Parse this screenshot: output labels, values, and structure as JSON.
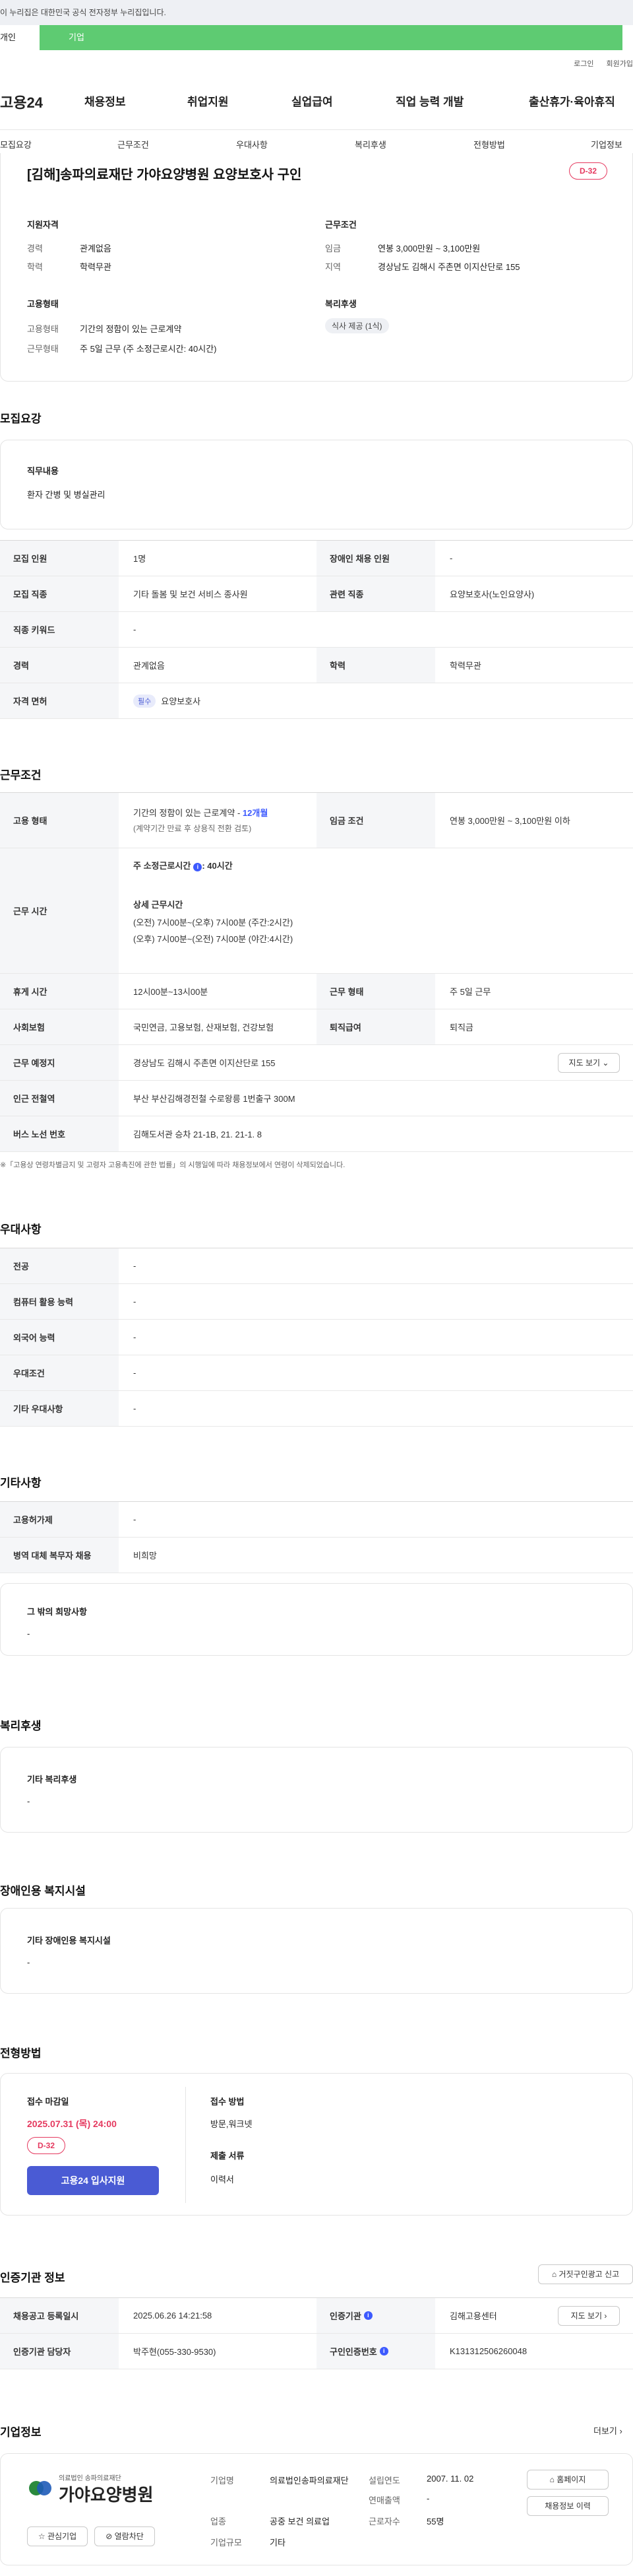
{
  "gov_banner": "이 누리집은 대한민국 공식 전자정부 누리집입니다.",
  "user_tabs": {
    "personal": "개인",
    "company": "기업"
  },
  "util": {
    "login": "로그인",
    "join": "회원가입"
  },
  "gnb": {
    "logo": "고용24",
    "menus": [
      "채용정보",
      "취업지원",
      "실업급여",
      "직업 능력 개발",
      "출산휴가·육아휴직"
    ]
  },
  "snb": [
    "모집요강",
    "근무조건",
    "우대사항",
    "복리후생",
    "전형방법",
    "기업정보"
  ],
  "summary": {
    "title": "[김해]송파의료재단 가야요양병원 요양보호사 구인",
    "dday": "D-32",
    "qualification": {
      "heading": "지원자격",
      "career_label": "경력",
      "career": "관계없음",
      "edu_label": "학력",
      "edu": "학력무관"
    },
    "employment": {
      "heading": "고용형태",
      "type_label": "고용형태",
      "type": "기간의 정함이 있는 근로계약",
      "form_label": "근무형태",
      "form": "주 5일 근무 (주 소정근로시간: 40시간)"
    },
    "conditions": {
      "heading": "근무조건",
      "wage_label": "임금",
      "wage": "연봉 3,000만원 ~ 3,100만원",
      "region_label": "지역",
      "region": "경상남도 김해시 주촌면 이지산단로 155"
    },
    "welfare": {
      "heading": "복리후생",
      "chip": "식사 제공 (1식)"
    }
  },
  "recruit": {
    "title": "모집요강",
    "duty_heading": "직무내용",
    "duty": "환자 간병 및 병실관리",
    "rows": [
      {
        "l1": "모집 인원",
        "v1": "1명",
        "l2": "장애인 채용 인원",
        "v2": "-"
      },
      {
        "l1": "모집 직종",
        "v1": "기타 돌봄 및 보건 서비스 종사원",
        "l2": "관련 직종",
        "v2": "요양보호사(노인요양사)"
      },
      {
        "l1": "직종 키워드",
        "v1": "-"
      },
      {
        "l1": "경력",
        "v1": "관계없음",
        "l2": "학력",
        "v2": "학력무관"
      },
      {
        "l1": "자격 면허",
        "pill": "필수",
        "v1": "요양보호사"
      }
    ]
  },
  "work": {
    "title": "근무조건",
    "emp_label": "고용 형태",
    "emp_line1": "기간의 정함이 있는 근로계약 - ",
    "emp_months": "12개월",
    "emp_line2": "(계약기간 만료 후 상용직 전환 검토)",
    "wage_label": "임금 조건",
    "wage": "연봉 3,000만원 ~ 3,100만원 이하",
    "hours_label": "근무 시간",
    "hours_weekly_label": "주 소정근로시간",
    "hours_weekly": ": 40시간",
    "hours_detail_heading": "상세 근무시간",
    "hours_detail": [
      "(오전) 7시00분~(오후) 7시00분  (주간:2시간)",
      "(오후) 7시00분~(오전) 7시00분  (야간:4시간)"
    ],
    "break_label": "휴게 시간",
    "break": "12시00분~13시00분",
    "form_label": "근무 형태",
    "form": "주 5일 근무",
    "insurance_label": "사회보험",
    "insurance": "국민연금, 고용보험, 산재보험, 건강보험",
    "severance_label": "퇴직급여",
    "severance": "퇴직금",
    "place_label": "근무 예정지",
    "place": "경상남도 김해시 주촌면 이지산단로 155",
    "map_btn": "지도 보기",
    "station_label": "인근 전철역",
    "station": "부산 부산김해경전철 수로왕릉 1번출구 300M",
    "bus_label": "버스 노선 번호",
    "bus": "김해도서관 승차 21-1B, 21. 21-1. 8",
    "note": "※「고용상 연령차별금지 및 고령자 고용촉진에 관한 법률」의 시행일에 따라 채용정보에서 연령이 삭제되었습니다."
  },
  "preference": {
    "title": "우대사항",
    "rows": [
      {
        "l": "전공",
        "v": "-"
      },
      {
        "l": "컴퓨터 활용 능력",
        "v": "-"
      },
      {
        "l": "외국어 능력",
        "v": "-"
      },
      {
        "l": "우대조건",
        "v": "-"
      },
      {
        "l": "기타 우대사항",
        "v": "-"
      }
    ]
  },
  "etc": {
    "title": "기타사항",
    "rows": [
      {
        "l": "고용허가제",
        "v": "-"
      },
      {
        "l": "병역 대체 복무자 채용",
        "v": "비희망"
      }
    ],
    "other_heading": "그 밖의 희망사항",
    "other": "-"
  },
  "welfare": {
    "title": "복리후생",
    "heading": "기타 복리후생",
    "value": "-"
  },
  "disability": {
    "title": "장애인용 복지시설",
    "heading": "기타 장애인용 복지시설",
    "value": "-"
  },
  "selection": {
    "title": "전형방법",
    "deadline_label": "접수 마감일",
    "deadline": "2025.07.31 (목) 24:00",
    "dday": "D-32",
    "apply_btn": "고용24 입사지원",
    "method_label": "접수 방법",
    "method": "방문,워크넷",
    "docs_label": "제출 서류",
    "docs": "이력서"
  },
  "cert": {
    "title": "인증기관 정보",
    "report_btn": "거짓구인광고 신고",
    "reg_label": "채용공고 등록일시",
    "reg": "2025.06.26 14:21:58",
    "org_label": "인증기관",
    "org": "김해고용센터",
    "map_btn": "지도 보기",
    "manager_label": "인증기관 담당자",
    "manager": "박주현(055-330-9530)",
    "no_label": "구인인증번호",
    "no": "K131312506260048"
  },
  "company": {
    "title": "기업정보",
    "more": "더보기",
    "logo_top": "의료법인 송파의료재단",
    "logo_name": "가야요양병원",
    "interest_btn": "관심기업",
    "block_btn": "열람차단",
    "name_label": "기업명",
    "name": "의료법인송파의료재단",
    "industry_label": "업종",
    "industry": "공중 보건 의료업",
    "scale_label": "기업규모",
    "scale": "기타",
    "founded_label": "설립연도",
    "founded": "2007. 11. 02",
    "sales_label": "연매출액",
    "sales": "-",
    "workers_label": "근로자수",
    "workers": "55명",
    "home_btn": "홈페이지",
    "jobs_btn": "채용정보 이력"
  }
}
